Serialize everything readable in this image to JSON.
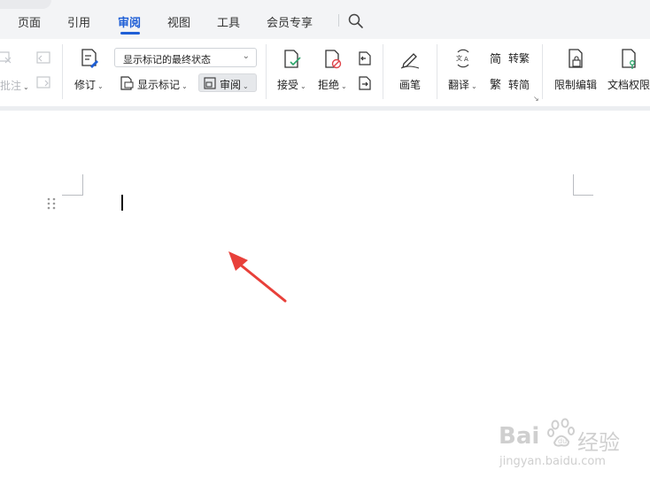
{
  "tabs": [
    {
      "label": "页面"
    },
    {
      "label": "引用"
    },
    {
      "label": "审阅",
      "active": true
    },
    {
      "label": "视图"
    },
    {
      "label": "工具"
    },
    {
      "label": "会员专享"
    }
  ],
  "ribbon": {
    "comment_label": "批注",
    "revise_label": "修订",
    "markup_state_value": "显示标记的最终状态",
    "show_markup_label": "显示标记",
    "review_pane_label": "审阅",
    "accept_label": "接受",
    "reject_label": "拒绝",
    "pen_label": "画笔",
    "translate_label": "翻译",
    "to_traditional_label": "转繁",
    "to_simplified_label": "转简",
    "restrict_edit_label": "限制编辑",
    "doc_permission_label": "文档权限"
  },
  "watermark": {
    "brand": "Bai",
    "brand_suffix": "经验",
    "url": "jingyan.baidu.com"
  },
  "colors": {
    "accent": "#1f5fd6",
    "arrow": "#e8403a",
    "reject_icon": "#e0444a",
    "permission_icon": "#2aa66a"
  }
}
